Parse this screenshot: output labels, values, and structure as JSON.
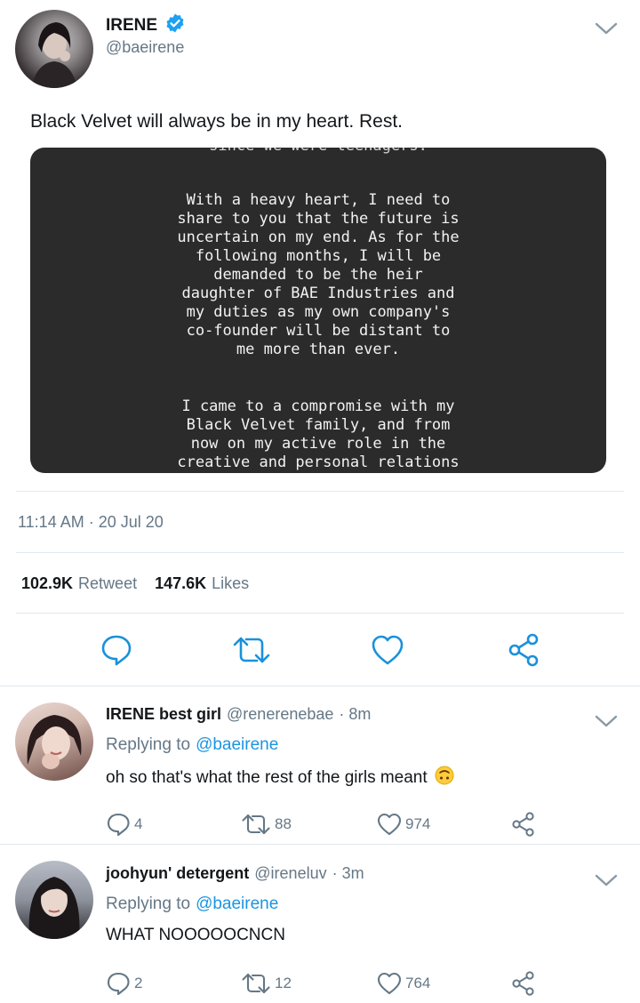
{
  "main_tweet": {
    "display_name": "IRENE",
    "handle": "@baeirene",
    "text": "Black Velvet will always be in my heart. Rest.",
    "image_text": {
      "cut_line": "since we were teenagers.",
      "paragraph1": [
        "With a heavy heart, I need to",
        "share to you that the future is",
        "uncertain on my end. As for the",
        "following months, I will be",
        "demanded to be the heir",
        "daughter of BAE Industries and",
        "my duties as my own company's",
        "co-founder will be distant to",
        "me more than ever."
      ],
      "paragraph2": [
        "I came to a compromise with my",
        "Black Velvet family, and from",
        "now on my active role in the",
        "creative and personal relations"
      ]
    },
    "timestamp": "11:14 AM · 20 Jul 20",
    "retweets_count": "102.9K",
    "retweets_label": "Retweet",
    "likes_count": "147.6K",
    "likes_label": "Likes"
  },
  "replies": [
    {
      "display_name": "IRENE best girl",
      "handle": "@renerenebae",
      "time": "· 8m",
      "replying_prefix": "Replying to",
      "replying_to": "@baeirene",
      "text": "oh so that's what the rest of the girls meant",
      "emoji": "upside-down-face",
      "replies": "4",
      "retweets": "88",
      "likes": "974"
    },
    {
      "display_name": "joohyun' detergent",
      "handle": "@ireneluv",
      "time": "· 3m",
      "replying_prefix": "Replying to",
      "replying_to": "@baeirene",
      "text": "WHAT NOOOOOCNCN",
      "replies": "2",
      "retweets": "12",
      "likes": "764"
    }
  ],
  "colors": {
    "verified": "#1da1f2",
    "link": "#1b95e0",
    "muted": "#657786",
    "icon": "#657786",
    "main_icon": "#1a91da"
  }
}
